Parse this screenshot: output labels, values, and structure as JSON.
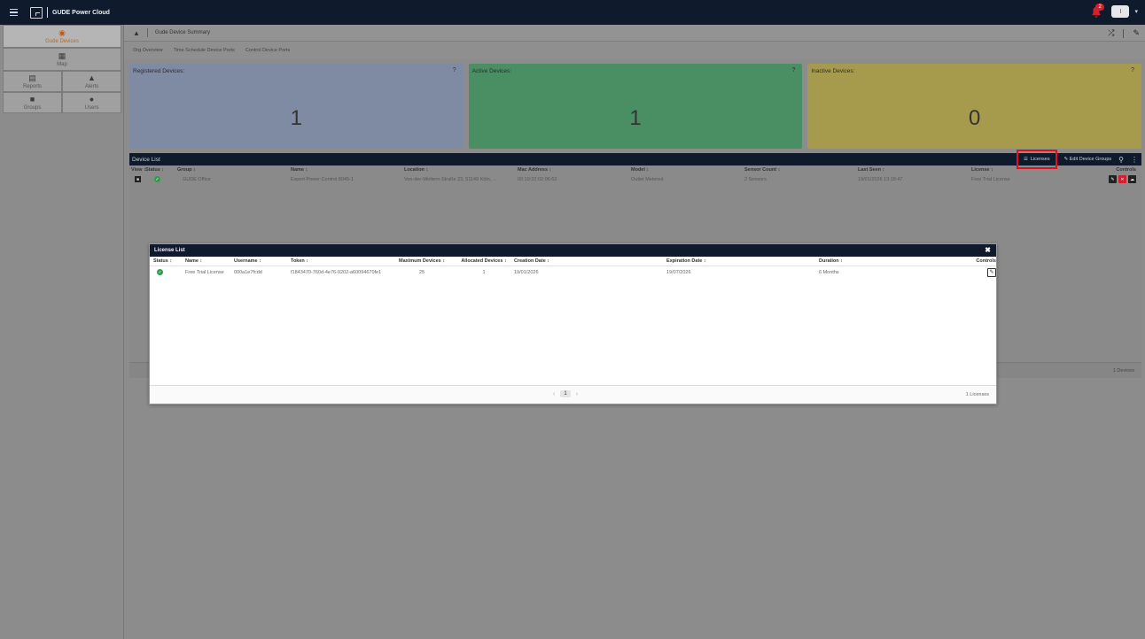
{
  "app": {
    "title": "GUDE Power Cloud",
    "notifications_count": "2",
    "user_initial": "I"
  },
  "sidebar": {
    "items": [
      {
        "label": "Gude Devices",
        "icon": "power-icon"
      },
      {
        "label": "Map",
        "icon": "map-icon"
      },
      {
        "label": "Reports",
        "icon": "report-icon"
      },
      {
        "label": "Alerts",
        "icon": "bell-icon"
      },
      {
        "label": "Groups",
        "icon": "groups-icon"
      },
      {
        "label": "Users",
        "icon": "users-icon"
      }
    ]
  },
  "header": {
    "breadcrumb": "Gude Device Summary",
    "tabs": [
      "Org Overview",
      "Time Schedule Device Ports",
      "Control Device Ports"
    ]
  },
  "cards": [
    {
      "label": "Registered Devices:",
      "value": "1",
      "help": "?",
      "color": "#7f8aa3"
    },
    {
      "label": "Active Devices:",
      "value": "1",
      "help": "?",
      "color": "#4a8e63"
    },
    {
      "label": "Inactive Devices:",
      "value": "0",
      "help": "?",
      "color": "#a69a4c"
    }
  ],
  "device_list": {
    "title": "Device List",
    "tools": {
      "licenses": "Licenses",
      "edit_groups": "Edit Device Groups"
    },
    "columns": [
      "View ↕",
      "Status ↕",
      "Group ↕",
      "Name ↕",
      "Location ↕",
      "Mac Address ↕",
      "Model ↕",
      "Sensor Count ↕",
      "Last Seen ↕",
      "License ↕",
      "Controls"
    ],
    "rows": [
      {
        "group": "GUDE Office",
        "name": "Expert Power Control 8045-1",
        "location": "Von-der-Wettern-Straße 23, 51149 Köln, ...",
        "mac": "00:19:32:02:06:63",
        "model": "Outlet Metered",
        "sensors": "2 Sensors",
        "last_seen": "19/01/2026 13:18:47",
        "license": "Free Trial License"
      }
    ],
    "footer": "1 Devices"
  },
  "license_modal": {
    "title": "License List",
    "columns": [
      "Status ↕",
      "Name ↕",
      "Username ↕",
      "Token ↕",
      "Maximum Devices ↕",
      "Allocated Devices ↕",
      "Creation Date ↕",
      "Expiration Date ↕",
      "Duration ↕",
      "Controls"
    ],
    "rows": [
      {
        "name": "Free Trial License",
        "username": "000a1e7fcdd",
        "token": "f1843470-760d-4e76-9202-a60094670fe1",
        "max_devices": "25",
        "allocated": "1",
        "created": "19/01/2026",
        "expires": "19/07/2026",
        "duration": "6 Months"
      }
    ],
    "page": "1",
    "footer": "1 Licenses"
  }
}
